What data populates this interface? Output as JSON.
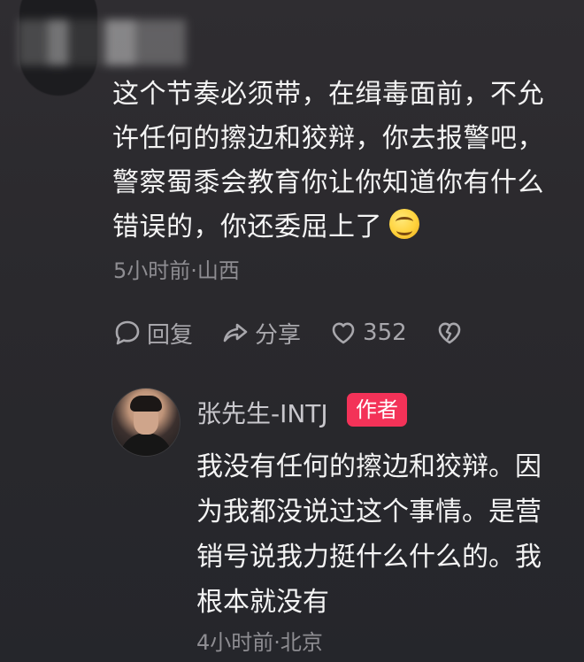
{
  "comment": {
    "text": "这个节奏必须带，在缉毒面前，不允许任何的擦边和狡辩，你去报警吧，警察蜀黍会教育你让你知道你有什么错误的，你还委屈上了",
    "emoji": "smile-emoji",
    "time": "5小时前",
    "location": "山西",
    "meta": "5小时前·山西",
    "reply_label": "回复",
    "share_label": "分享",
    "like_count": "352"
  },
  "reply": {
    "user_name": "张先生-INTJ",
    "badge": "作者",
    "text": "我没有任何的擦边和狡辩。因为我都没说过这个事情。是营销号说我力挺什么什么的。我根本就没有",
    "meta": "4小时前·北京"
  },
  "colors": {
    "background": "#2b2a2f",
    "accent_badge": "#f33258",
    "muted_text": "#8e8d92",
    "text": "#f4f4f4"
  }
}
